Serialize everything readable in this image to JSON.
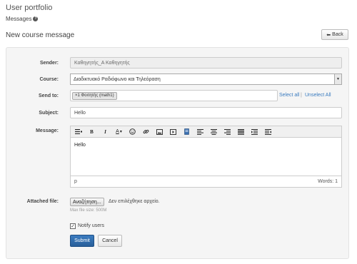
{
  "header": {
    "title": "User portfolio",
    "subtitle": "Messages",
    "help_icon": "help-icon"
  },
  "section": {
    "title": "New course message",
    "back_label": "Back",
    "back_icon": "back-arrow-icon"
  },
  "form": {
    "sender": {
      "label": "Sender:",
      "value": "Καθηγητής_Α Καθηγητής"
    },
    "course": {
      "label": "Course:",
      "value": "Διαδικτυακό Ραδιόφωνο και Τηλεόραση"
    },
    "send_to": {
      "label": "Send to:",
      "chip": "×1 Φοιτητής (math1)",
      "select_all": "Select all",
      "separator": "|",
      "unselect_all": "Unselect All"
    },
    "subject": {
      "label": "Subject:",
      "value": "Hello"
    },
    "message": {
      "label": "Message:",
      "toolbar": {
        "bold": "B",
        "italic": "I",
        "text_color": "A",
        "dropdown": "▾"
      },
      "body": "Hello",
      "status_path": "p",
      "word_count": "Words: 1"
    },
    "attachment": {
      "label": "Attached file:",
      "button_label": "Αναζήτηση...",
      "status": "Δεν επιλέχθηκε αρχείο.",
      "hint": "Max file size: 500M"
    },
    "notify": {
      "label": "Notify users",
      "checked": true,
      "checkmark": "✓"
    },
    "submit_label": "Submit",
    "cancel_label": "Cancel"
  },
  "colors": {
    "accent": "#2f6da8",
    "link": "#3a7bbf",
    "panel_bg": "#f5f5f5"
  }
}
